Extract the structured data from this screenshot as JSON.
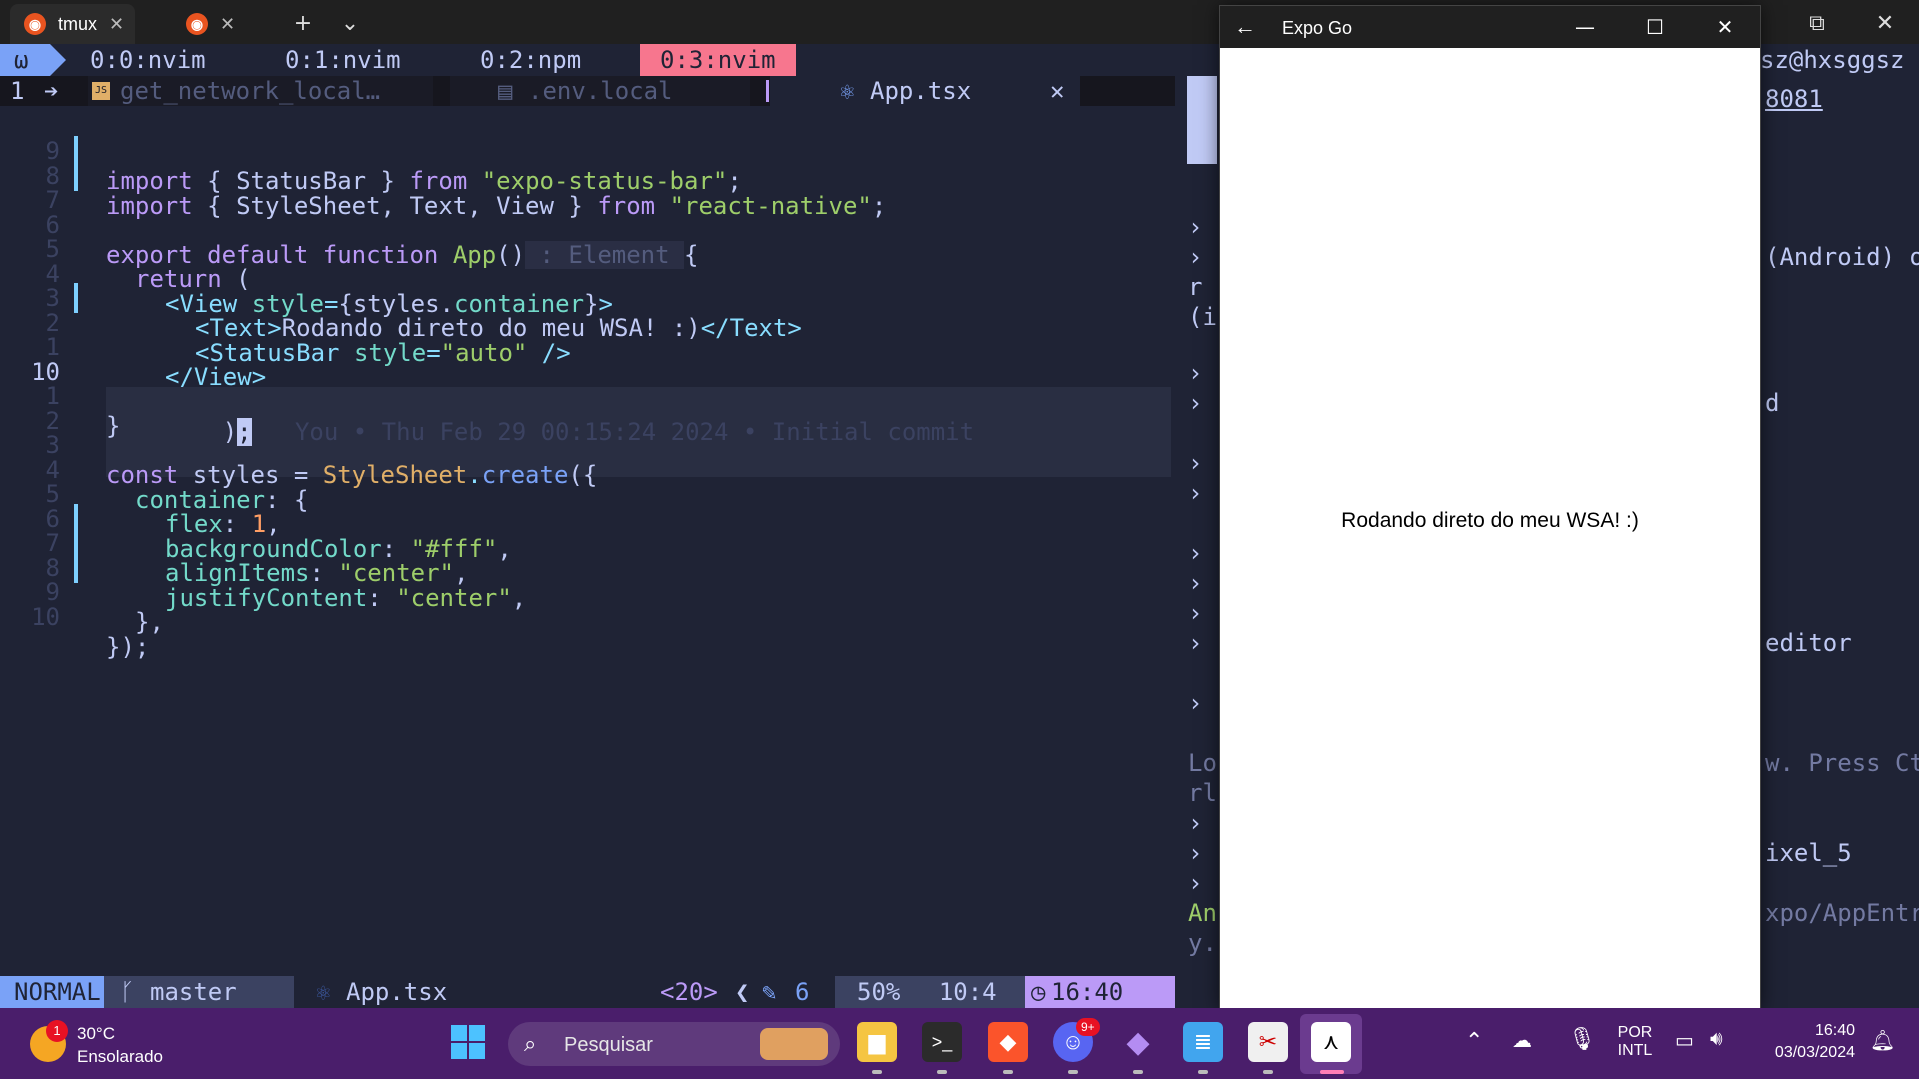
{
  "terminal": {
    "tabs": [
      {
        "label": "tmux",
        "close": "✕"
      },
      {
        "label": "",
        "close": "✕"
      }
    ],
    "new_tab": "+",
    "dropdown": "⌄",
    "win_restore": "⧉",
    "win_close": "✕"
  },
  "tmux": {
    "session": "ω",
    "windows": [
      "0:0:nvim",
      "0:1:nvim",
      "0:2:npm",
      "0:3:nvim"
    ],
    "user": "sz@hxsggsz"
  },
  "bufferline": {
    "tabnr": "1",
    "buffers": [
      "get_network_local…",
      ".env.local",
      "App.tsx"
    ],
    "close": "✕"
  },
  "editor": {
    "lines": [
      {
        "n": "9",
        "g": true
      },
      {
        "n": "8",
        "g": true
      },
      {
        "n": "7",
        "g": false
      },
      {
        "n": "6",
        "g": false
      },
      {
        "n": "5",
        "g": false
      },
      {
        "n": "4",
        "g": false
      },
      {
        "n": "3",
        "g": true
      },
      {
        "n": "2",
        "g": false
      },
      {
        "n": "1",
        "g": false
      },
      {
        "n": "10",
        "g": false
      },
      {
        "n": "1",
        "g": false
      },
      {
        "n": "2",
        "g": false
      },
      {
        "n": "3",
        "g": false
      },
      {
        "n": "4",
        "g": false
      },
      {
        "n": "5",
        "g": false
      },
      {
        "n": "6",
        "g": true
      },
      {
        "n": "7",
        "g": true
      },
      {
        "n": "8",
        "g": true
      },
      {
        "n": "9",
        "g": false
      },
      {
        "n": "10",
        "g": false
      }
    ],
    "code": {
      "l1": [
        "import",
        " { ",
        "StatusBar",
        " } ",
        "from",
        " ",
        "\"expo-status-bar\"",
        ";"
      ],
      "l2": [
        "import",
        " { ",
        "StyleSheet, Text, View",
        " } ",
        "from",
        " ",
        "\"react-native\"",
        ";"
      ],
      "l4": [
        "export",
        " ",
        "default",
        " ",
        "function",
        " ",
        "App",
        "()",
        " : Element ",
        "{"
      ],
      "l5": [
        "return",
        " ("
      ],
      "l6": [
        "<View",
        " ",
        "style",
        "=",
        "{styles.",
        "container",
        "}",
        ">"
      ],
      "l7": [
        "<Text>",
        "Rodando direto do meu WSA! :)",
        "</Text>"
      ],
      "l8": [
        "<StatusBar",
        " ",
        "style",
        "=",
        "\"auto\"",
        " />"
      ],
      "l9": [
        "</View>"
      ],
      "l10": [
        ")",
        ";",
        "You • Thu Feb 29 00:15:24 2024 • Initial commit"
      ],
      "l11": [
        "}"
      ],
      "l13": [
        "const",
        " styles = ",
        "StyleSheet",
        ".",
        "create",
        "({"
      ],
      "l14": [
        "container",
        ": {"
      ],
      "l15": [
        "flex",
        ": ",
        "1",
        ","
      ],
      "l16": [
        "backgroundColor",
        ": ",
        "\"#fff\"",
        ","
      ],
      "l17": [
        "alignItems",
        ": ",
        "\"center\"",
        ","
      ],
      "l18": [
        "justifyContent",
        ": ",
        "\"center\"",
        ","
      ],
      "l19": [
        "},"
      ],
      "l20": [
        "});"
      ]
    }
  },
  "statusline": {
    "mode": "NORMAL",
    "branch": "master",
    "file": "App.tsx",
    "diag": "<20>",
    "count": "6",
    "percent": "50%",
    "position": "10:4",
    "time": "16:40"
  },
  "right_pane": {
    "lines": [
      {
        "l": "›",
        "r": ""
      },
      {
        "l": "›",
        "r": "(Android) o"
      },
      {
        "l": "r",
        "r": ""
      },
      {
        "l": "(i",
        "r": ""
      },
      {
        "l": "›",
        "r": ""
      },
      {
        "l": "›",
        "r": "d"
      },
      {
        "l": "›",
        "r": ""
      },
      {
        "l": "›",
        "r": ""
      },
      {
        "l": "›",
        "r": ""
      },
      {
        "l": "›",
        "r": ""
      },
      {
        "l": "›",
        "r": ""
      },
      {
        "l": "›",
        "r": "editor"
      },
      {
        "l": "›",
        "r": ""
      },
      {
        "l": "Lo",
        "r": "w. Press Ct"
      },
      {
        "l": "rl",
        "r": ""
      },
      {
        "l": "›",
        "r": ""
      },
      {
        "l": "›",
        "r": "ixel_5"
      },
      {
        "l": "›",
        "r": ""
      },
      {
        "l": "An",
        "r": "xpo/AppEntr"
      },
      {
        "l": "y.",
        "r": ""
      }
    ],
    "port": "8081"
  },
  "expo": {
    "title": "Expo Go",
    "back": "←",
    "minimize": "—",
    "maximize": "☐",
    "close": "✕",
    "content_text": "Rodando direto do meu WSA! :)"
  },
  "taskbar": {
    "weather_temp": "30°C",
    "weather_desc": "Ensolarado",
    "weather_badge": "1",
    "search_placeholder": "Pesquisar",
    "discord_badge": "9+",
    "lang1": "POR",
    "lang2": "INTL",
    "time": "16:40",
    "date": "03/03/2024"
  },
  "colors": {
    "editor_bg": "#1f2335",
    "taskbar_bg": "#4a1e6b",
    "accent_pink": "#f7768e",
    "accent_blue": "#7aa2f7",
    "mode_bg": "#7aa2f7"
  }
}
